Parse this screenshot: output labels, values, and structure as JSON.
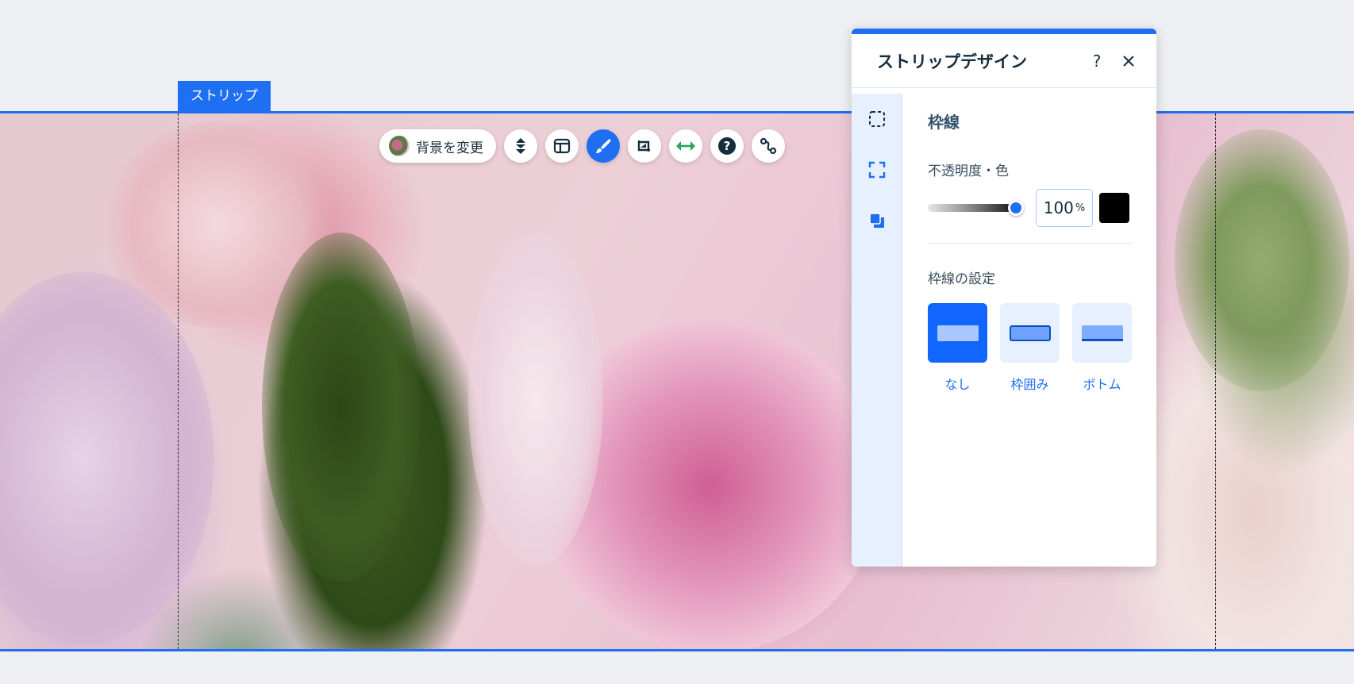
{
  "strip": {
    "tag_label": "ストリップ"
  },
  "toolbar": {
    "change_bg_label": "背景を変更",
    "buttons": [
      "arrange-icon",
      "layout-icon",
      "design-icon",
      "crop-icon",
      "stretch-icon",
      "help-icon",
      "animation-icon"
    ]
  },
  "panel": {
    "title": "ストリップデザイン",
    "help": "?",
    "close": "✕",
    "section_title": "枠線",
    "opacity_label": "不透明度・色",
    "opacity_value": "100",
    "opacity_unit": "%",
    "color": "#000000",
    "border_settings_label": "枠線の設定",
    "options": [
      {
        "label": "なし",
        "selected": true
      },
      {
        "label": "枠囲み",
        "selected": false
      },
      {
        "label": "ボトム",
        "selected": false
      }
    ]
  },
  "colors": {
    "accent": "#1e6ff2"
  }
}
